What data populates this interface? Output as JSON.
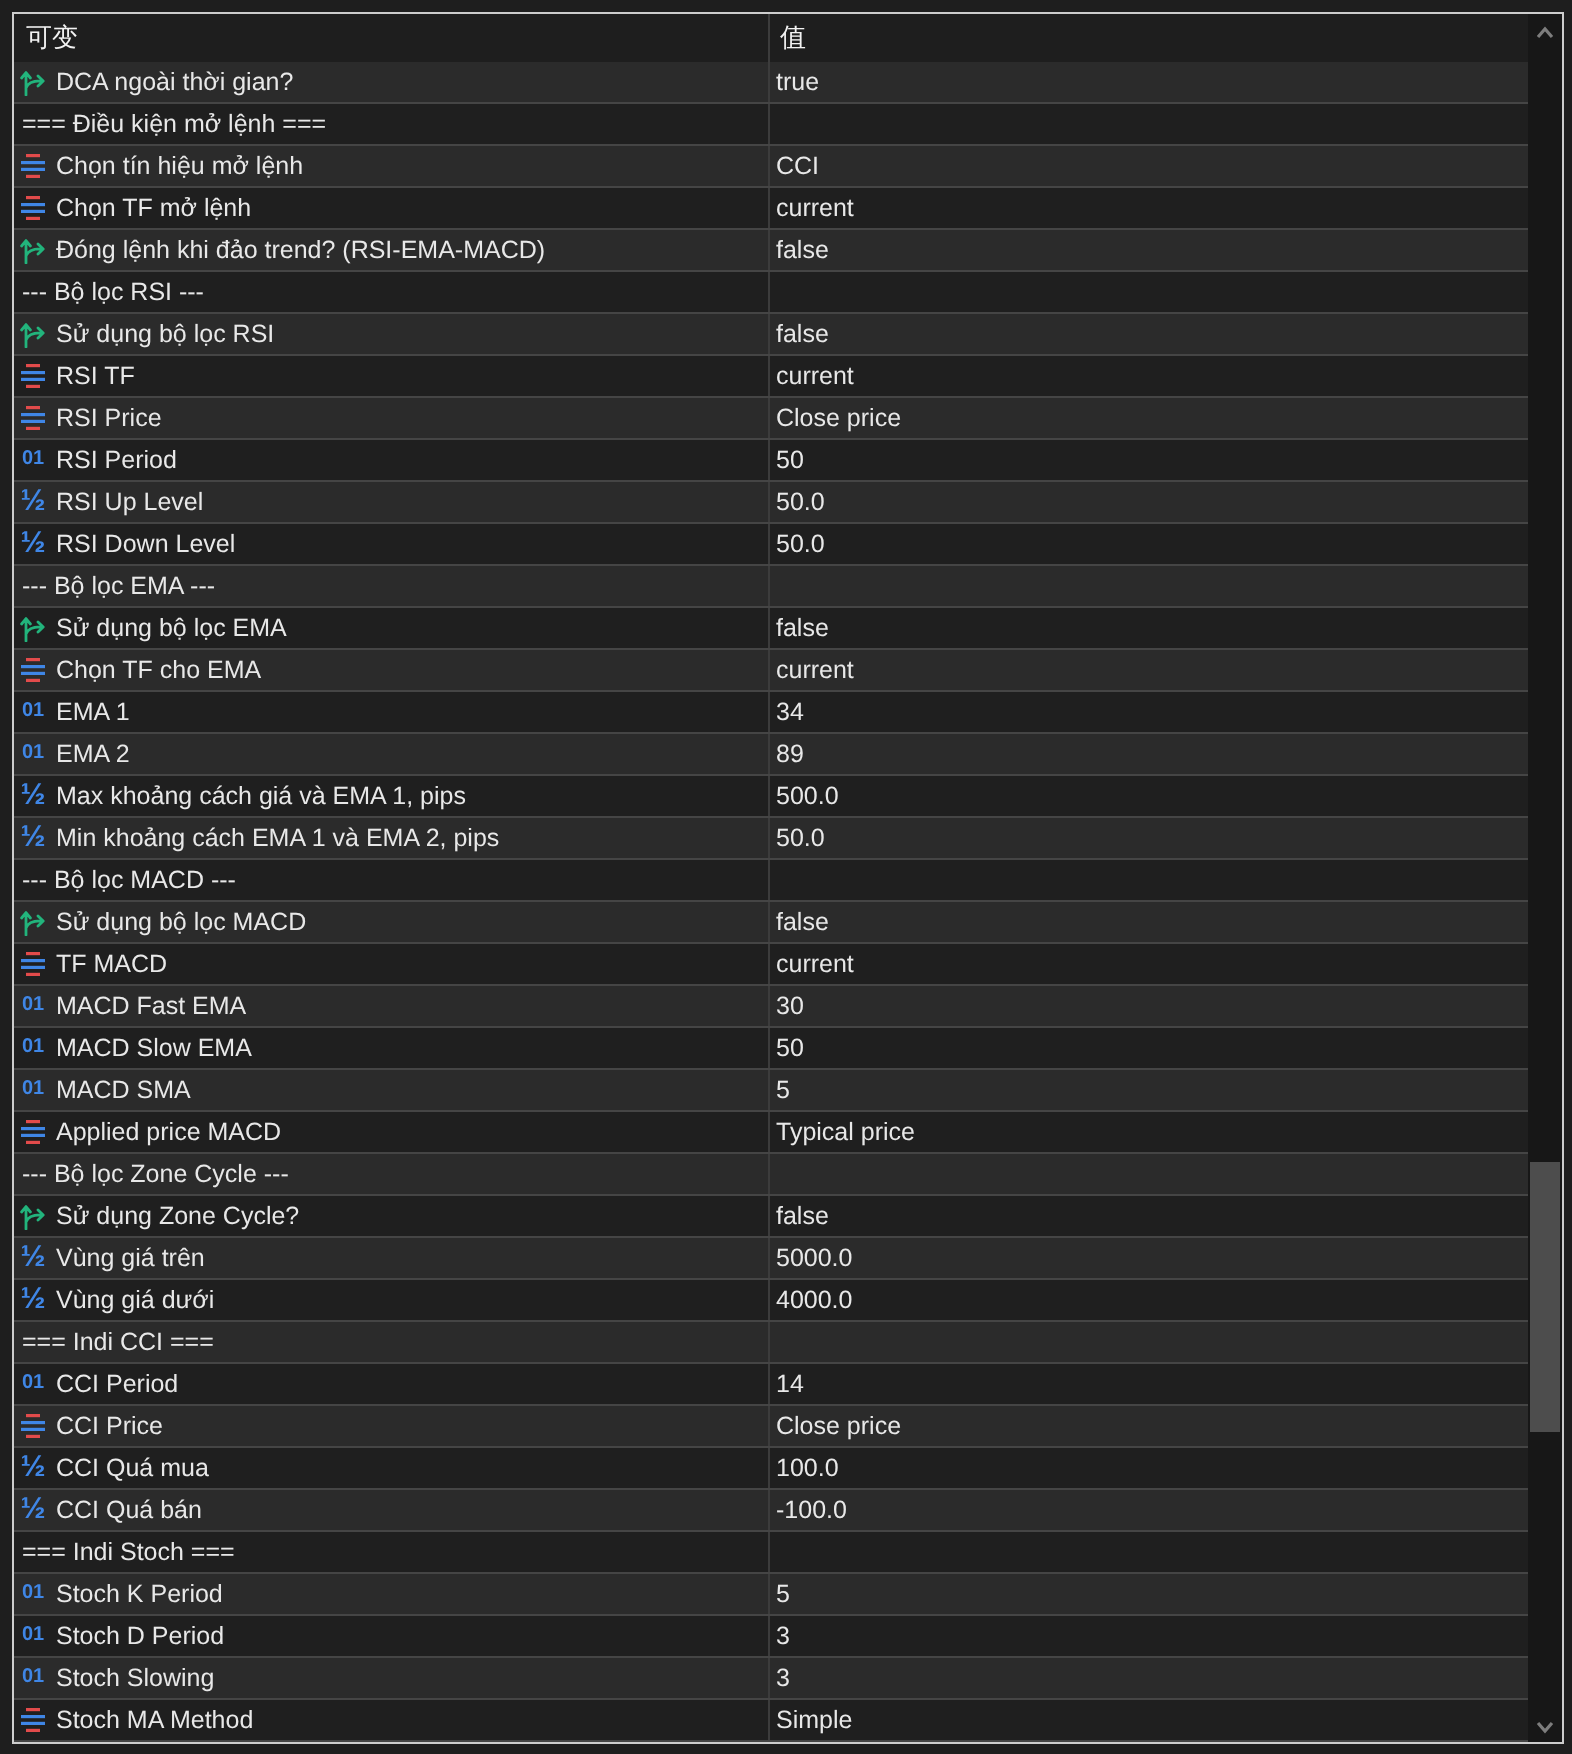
{
  "columns": [
    {
      "label": "可变"
    },
    {
      "label": "值"
    }
  ],
  "rows": [
    {
      "kind": "bool",
      "name": "DCA ngoài thời gian?",
      "value": "true"
    },
    {
      "kind": "separator",
      "name": "=== Điều kiện mở lệnh ==="
    },
    {
      "kind": "enum",
      "name": "Chọn tín hiệu mở lệnh",
      "value": "CCI"
    },
    {
      "kind": "enum",
      "name": "Chọn TF mở lệnh",
      "value": "current"
    },
    {
      "kind": "bool",
      "name": "Đóng lệnh khi đảo trend? (RSI-EMA-MACD)",
      "value": "false"
    },
    {
      "kind": "separator",
      "name": "--- Bộ lọc RSI ---"
    },
    {
      "kind": "bool",
      "name": "Sử dụng bộ lọc RSI",
      "value": "false"
    },
    {
      "kind": "enum",
      "name": "RSI TF",
      "value": "current"
    },
    {
      "kind": "enum",
      "name": "RSI Price",
      "value": "Close price"
    },
    {
      "kind": "int",
      "type_label": "01",
      "name": "RSI Period",
      "value": "50"
    },
    {
      "kind": "double",
      "type_label": "½",
      "name": "RSI Up Level",
      "value": "50.0"
    },
    {
      "kind": "double",
      "type_label": "½",
      "name": "RSI Down Level",
      "value": "50.0"
    },
    {
      "kind": "separator",
      "name": "--- Bộ lọc EMA ---"
    },
    {
      "kind": "bool",
      "name": "Sử dụng bộ lọc EMA",
      "value": "false"
    },
    {
      "kind": "enum",
      "name": "Chọn TF cho EMA",
      "value": "current"
    },
    {
      "kind": "int",
      "type_label": "01",
      "name": "EMA 1",
      "value": "34"
    },
    {
      "kind": "int",
      "type_label": "01",
      "name": "EMA 2",
      "value": "89"
    },
    {
      "kind": "double",
      "type_label": "½",
      "name": "Max khoảng cách giá và EMA 1, pips",
      "value": "500.0"
    },
    {
      "kind": "double",
      "type_label": "½",
      "name": "Min khoảng cách EMA 1 và EMA 2, pips",
      "value": "50.0"
    },
    {
      "kind": "separator",
      "name": "--- Bộ lọc MACD ---"
    },
    {
      "kind": "bool",
      "name": "Sử dụng bộ lọc MACD",
      "value": "false"
    },
    {
      "kind": "enum",
      "name": "TF MACD",
      "value": "current"
    },
    {
      "kind": "int",
      "type_label": "01",
      "name": "MACD Fast EMA",
      "value": "30"
    },
    {
      "kind": "int",
      "type_label": "01",
      "name": "MACD Slow EMA",
      "value": "50"
    },
    {
      "kind": "int",
      "type_label": "01",
      "name": "MACD SMA",
      "value": "5"
    },
    {
      "kind": "enum",
      "name": "Applied price MACD",
      "value": "Typical price"
    },
    {
      "kind": "separator",
      "name": "--- Bộ lọc Zone Cycle ---"
    },
    {
      "kind": "bool",
      "name": "Sử dụng Zone Cycle?",
      "value": "false"
    },
    {
      "kind": "double",
      "type_label": "½",
      "name": "Vùng giá trên",
      "value": "5000.0"
    },
    {
      "kind": "double",
      "type_label": "½",
      "name": "Vùng giá dưới",
      "value": "4000.0"
    },
    {
      "kind": "separator",
      "name": "=== Indi CCI ==="
    },
    {
      "kind": "int",
      "type_label": "01",
      "name": "CCI Period",
      "value": "14"
    },
    {
      "kind": "enum",
      "name": "CCI Price",
      "value": "Close price"
    },
    {
      "kind": "double",
      "type_label": "½",
      "name": "CCI Quá mua",
      "value": "100.0"
    },
    {
      "kind": "double",
      "type_label": "½",
      "name": "CCI Quá bán",
      "value": "-100.0"
    },
    {
      "kind": "separator",
      "name": "=== Indi Stoch ==="
    },
    {
      "kind": "int",
      "type_label": "01",
      "name": "Stoch K Period",
      "value": "5"
    },
    {
      "kind": "int",
      "type_label": "01",
      "name": "Stoch D Period",
      "value": "3"
    },
    {
      "kind": "int",
      "type_label": "01",
      "name": "Stoch Slowing",
      "value": "3"
    },
    {
      "kind": "enum",
      "name": "Stoch MA Method",
      "value": "Simple"
    }
  ]
}
